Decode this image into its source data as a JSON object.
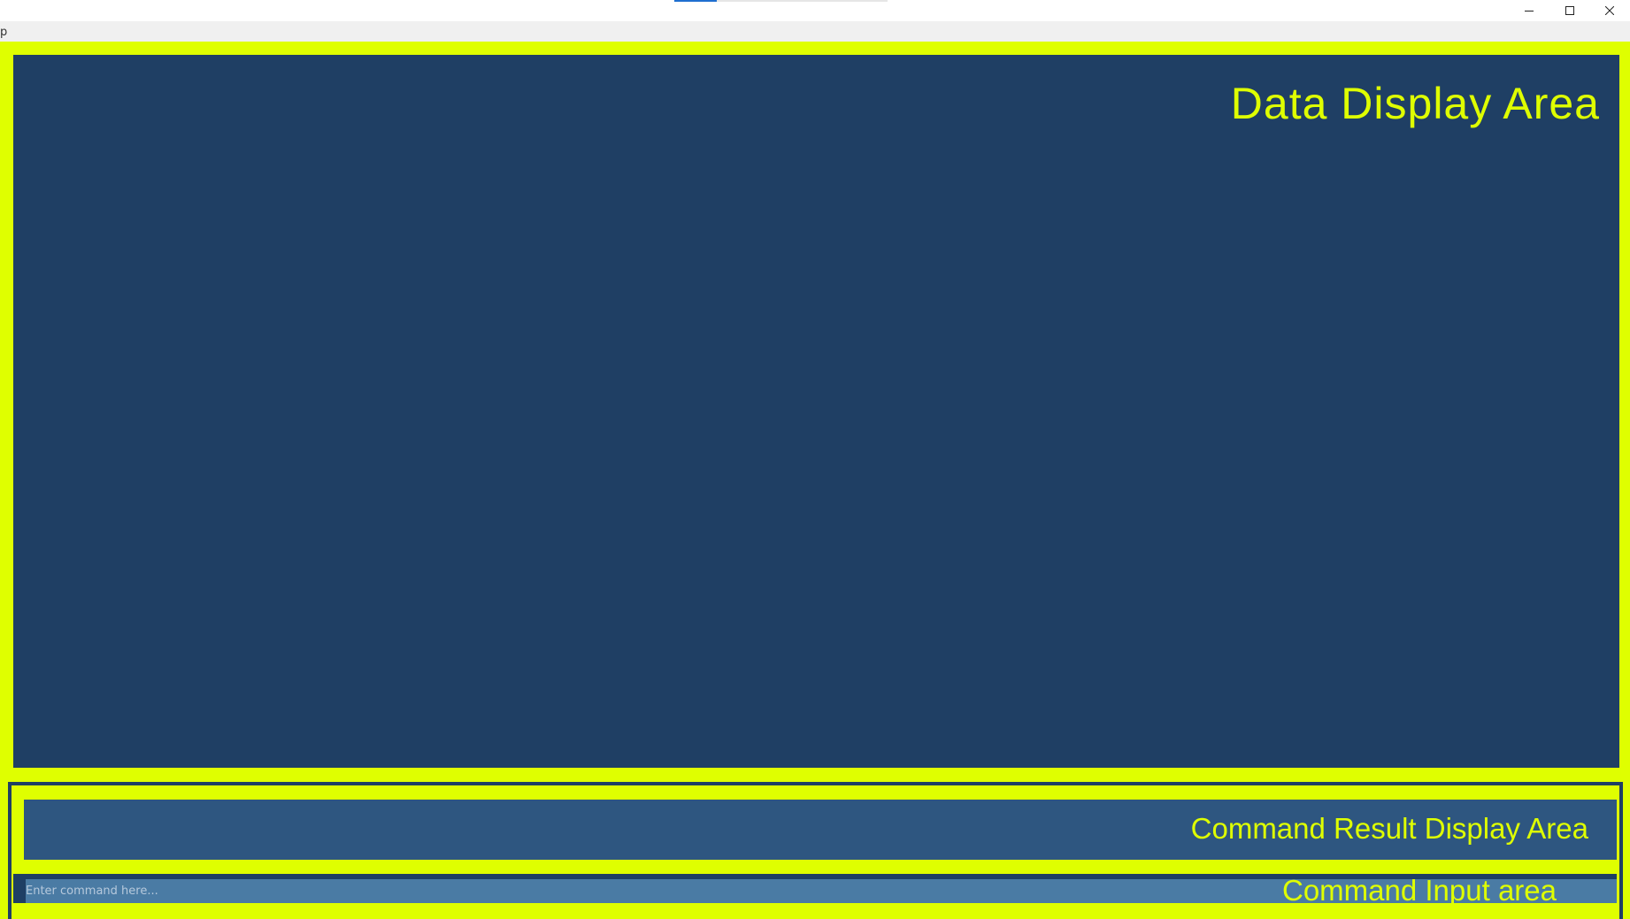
{
  "window": {
    "menu_item": "p",
    "icons": {
      "minimize": "minimize-icon",
      "maximize": "maximize-icon",
      "close": "close-icon"
    }
  },
  "data_display": {
    "label": "Data Display Area"
  },
  "result_display": {
    "label": "Command Result Display Area"
  },
  "command_input": {
    "label": "Command Input area",
    "placeholder": "Enter command here...",
    "value": ""
  },
  "colors": {
    "accent": "#dfff00",
    "panel_dark": "#1f3f64",
    "panel_mid": "#2e5680",
    "input_bg": "#4a7ba4"
  }
}
